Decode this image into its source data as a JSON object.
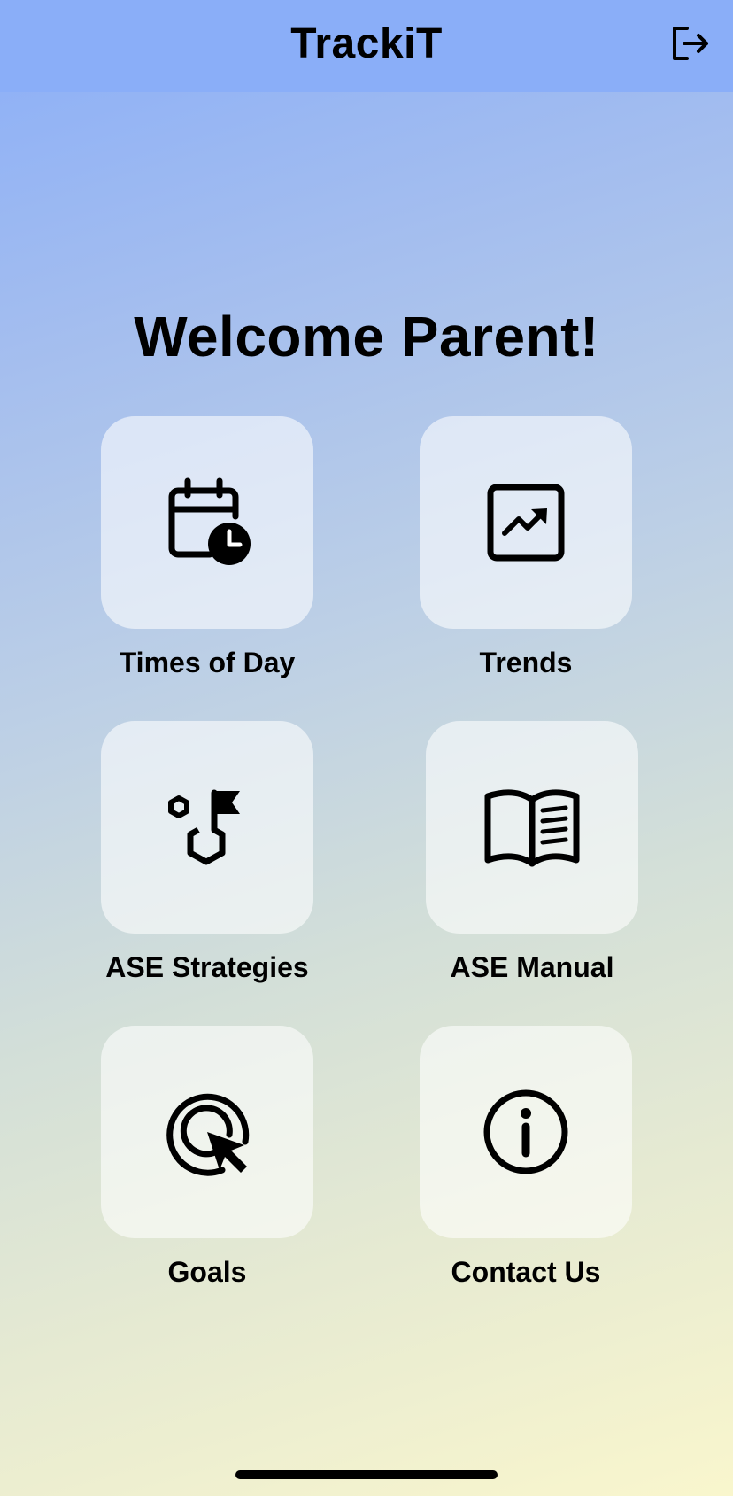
{
  "header": {
    "title": "TrackiT",
    "logout_icon": "logout-icon"
  },
  "welcome_text": "Welcome Parent!",
  "tiles": [
    {
      "label": "Times of Day",
      "icon": "calendar-clock-icon"
    },
    {
      "label": "Trends",
      "icon": "trend-chart-icon"
    },
    {
      "label": "ASE Strategies",
      "icon": "strategy-flag-icon"
    },
    {
      "label": "ASE Manual",
      "icon": "open-book-icon"
    },
    {
      "label": "Goals",
      "icon": "target-cursor-icon"
    },
    {
      "label": "Contact Us",
      "icon": "info-icon"
    }
  ],
  "colors": {
    "header_bg": "#8aaef8",
    "gradient_top": "#8aaef8",
    "gradient_bottom": "#f9f6cd",
    "text": "#000000"
  }
}
